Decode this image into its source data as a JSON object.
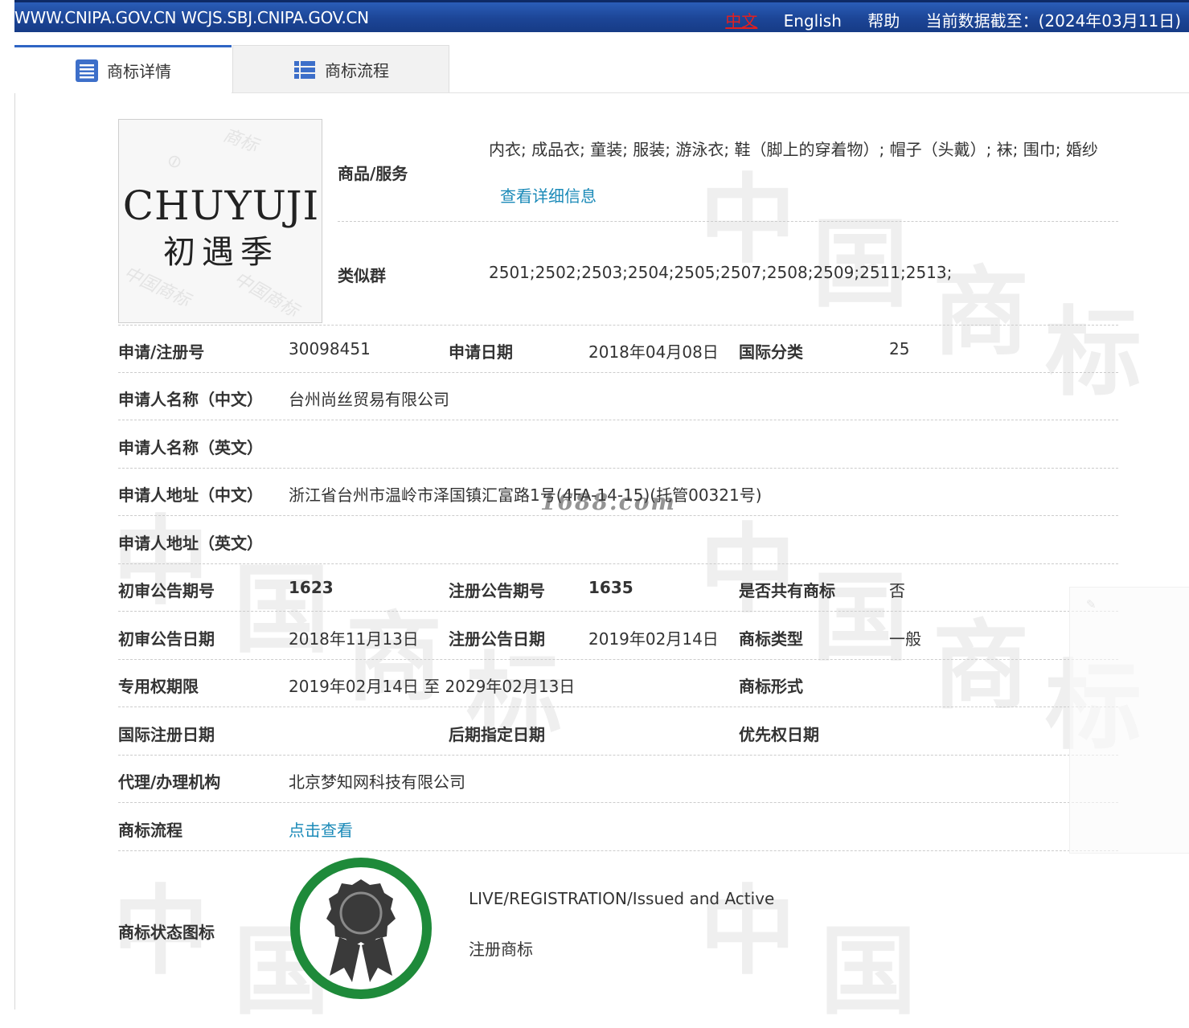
{
  "topbar": {
    "urls": "WWW.CNIPA.GOV.CN WCJS.SBJ.CNIPA.GOV.CN",
    "lang_zh": "中文",
    "lang_en": "English",
    "help": "帮助",
    "data_cutoff": "当前数据截至：(2024年03月11日)"
  },
  "tabs": [
    {
      "label": "商标详情"
    },
    {
      "label": "商标流程"
    }
  ],
  "trademark": {
    "image_text_en": "CHUYUJI",
    "image_text_zh": "初遇季",
    "goods_label": "商品/服务",
    "goods_value": "内衣; 成品衣; 童装; 服装; 游泳衣; 鞋（脚上的穿着物）; 帽子（头戴）; 袜; 围巾; 婚纱",
    "goods_detail_link": "查看详细信息",
    "similar_group_label": "类似群",
    "similar_group_value": "2501;2502;2503;2504;2505;2507;2508;2509;2511;2513;"
  },
  "details": {
    "reg_no_label": "申请/注册号",
    "reg_no": "30098451",
    "app_date_label": "申请日期",
    "app_date": "2018年04月08日",
    "intl_class_label": "国际分类",
    "intl_class": "25",
    "applicant_zh_label": "申请人名称（中文）",
    "applicant_zh": "台州尚丝贸易有限公司",
    "applicant_en_label": "申请人名称（英文）",
    "applicant_en": "",
    "address_zh_label": "申请人地址（中文）",
    "address_zh": "浙江省台州市温岭市泽国镇汇富路1号(4FA-14-15)(托管00321号)",
    "address_en_label": "申请人地址（英文）",
    "address_en": "",
    "prelim_no_label": "初审公告期号",
    "prelim_no": "1623",
    "reg_pub_no_label": "注册公告期号",
    "reg_pub_no": "1635",
    "shared_label": "是否共有商标",
    "shared": "否",
    "prelim_date_label": "初审公告日期",
    "prelim_date": "2018年11月13日",
    "reg_pub_date_label": "注册公告日期",
    "reg_pub_date": "2019年02月14日",
    "tm_type_label": "商标类型",
    "tm_type": "一般",
    "term_label": "专用权期限",
    "term": "2019年02月14日 至 2029年02月13日",
    "tm_form_label": "商标形式",
    "tm_form": "",
    "intl_reg_date_label": "国际注册日期",
    "intl_reg_date": "",
    "later_date_label": "后期指定日期",
    "later_date": "",
    "priority_date_label": "优先权日期",
    "priority_date": "",
    "agent_label": "代理/办理机构",
    "agent": "北京梦知网科技有限公司",
    "flow_label": "商标流程",
    "flow_link": "点击查看",
    "status_label": "商标状态图标",
    "status_en": "LIVE/REGISTRATION/Issued and Active",
    "status_zh": "注册商标"
  },
  "overlay": {
    "site_watermark": "1688.com"
  },
  "colors": {
    "topbar": "#1c4596",
    "link": "#1b8ab8",
    "active_tab_border": "#2f65c4",
    "badge_ring": "#1e8a3a",
    "badge_medal": "#3a3a3a"
  }
}
